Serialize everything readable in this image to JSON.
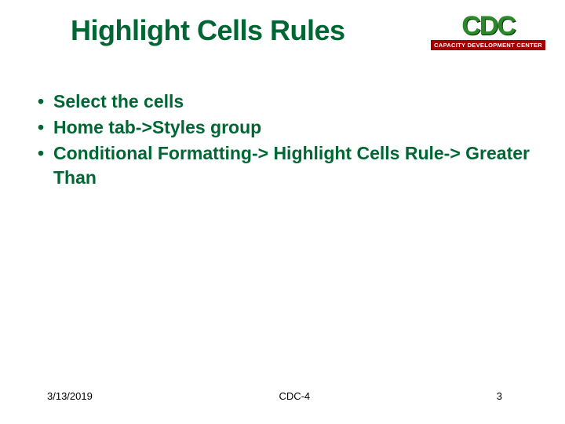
{
  "header": {
    "title": "Highlight Cells Rules",
    "logo": {
      "abbrev": "CDC",
      "subtitle": "CAPACITY DEVELOPMENT CENTER"
    }
  },
  "bullets": [
    "Select the cells",
    "Home tab->Styles group",
    "Conditional Formatting-> Highlight Cells Rule-> Greater Than"
  ],
  "footer": {
    "date": "3/13/2019",
    "center": "CDC-4",
    "page": "3"
  }
}
